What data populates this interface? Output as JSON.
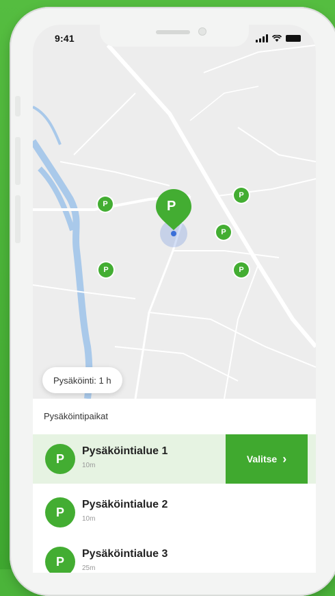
{
  "status_bar": {
    "time": "9:41"
  },
  "map": {
    "duration_pill": "Pysäköinti: 1 h",
    "main_pin_label": "P",
    "small_pins": [
      "P",
      "P",
      "P",
      "P",
      "P"
    ]
  },
  "list": {
    "title": "Pysäköintipaikat",
    "items": [
      {
        "badge": "P",
        "name": "Pysäköintialue 1",
        "distance": "10m",
        "selected": true
      },
      {
        "badge": "P",
        "name": "Pysäköintialue 2",
        "distance": "10m",
        "selected": false
      },
      {
        "badge": "P",
        "name": "Pysäköintialue 3",
        "distance": "25m",
        "selected": false
      }
    ],
    "select_button": "Valitse",
    "select_chevron": "›"
  },
  "colors": {
    "brand_green": "#43ad32",
    "selected_row": "#e6f3e2",
    "water": "#a9c9ea",
    "location_dot": "#3a6fd8"
  },
  "icons": [
    "signal-icon",
    "wifi-icon",
    "battery-icon",
    "parking-pin-icon",
    "location-dot-icon",
    "chevron-right-icon"
  ]
}
